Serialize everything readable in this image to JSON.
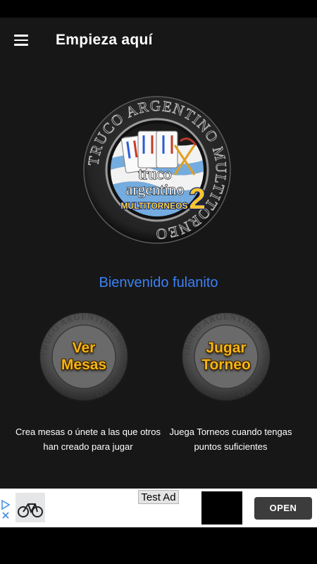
{
  "appbar": {
    "title": "Empieza aquí"
  },
  "logo": {
    "ring_text": "TRUCO ARGENTINO MULTITORNEO",
    "line1": "truco",
    "line2": "argentino",
    "line3": "MULTITORNEOS",
    "number": "2"
  },
  "welcome": "Bienvenido fulanito",
  "buttons": {
    "ver_mesas": {
      "line1": "Ver",
      "line2": "Mesas",
      "ring_text": "TRUCO ARGENTINO MULTITORNEO"
    },
    "jugar_torneo": {
      "line1": "Jugar",
      "line2": "Torneo",
      "ring_text": "TRUCO ARGENTINO MULTITORNEO"
    }
  },
  "descriptions": {
    "ver_mesas": "Crea mesas o únete a las que otros han creado para jugar",
    "jugar_torneo": "Juega Torneos cuando tengas puntos suficientes"
  },
  "ad": {
    "label": "Test Ad",
    "open_label": "OPEN"
  },
  "colors": {
    "accent_blue": "#3b82f6",
    "button_gold": "#f5b41a",
    "background": "#171717"
  }
}
